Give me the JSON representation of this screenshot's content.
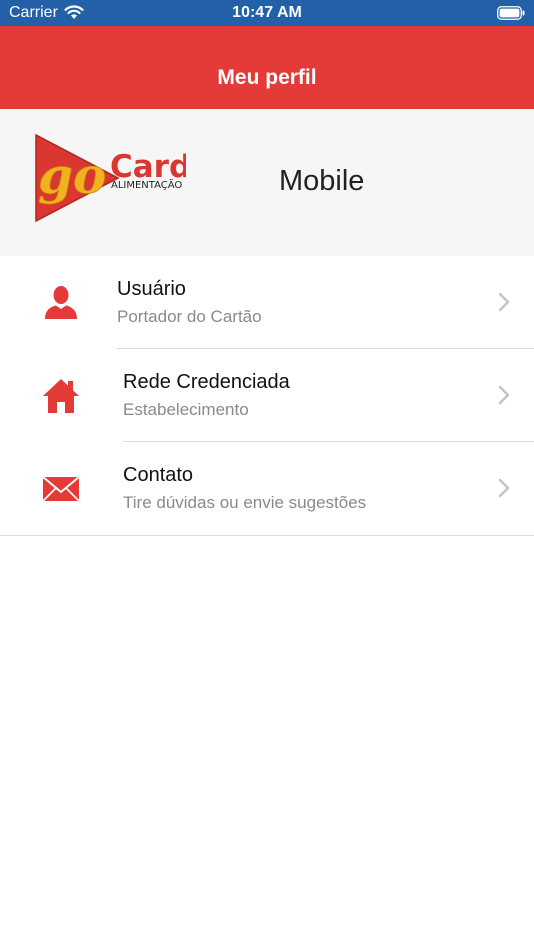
{
  "status": {
    "carrier": "Carrier",
    "time": "10:47 AM"
  },
  "navbar": {
    "title": "Meu perfil"
  },
  "header": {
    "logo": {
      "text_go": "go",
      "text_card": "Card",
      "text_sub": "ALIMENTAÇÃO"
    },
    "label": "Mobile"
  },
  "menu": {
    "items": [
      {
        "title": "Usuário",
        "subtitle": "Portador do Cartão",
        "icon": "user-icon"
      },
      {
        "title": "Rede Credenciada",
        "subtitle": "Estabelecimento",
        "icon": "home-icon"
      },
      {
        "title": "Contato",
        "subtitle": "Tire dúvidas ou envie sugestões",
        "icon": "mail-icon"
      }
    ]
  },
  "colors": {
    "status_bar": "#2360a8",
    "accent": "#e53b38",
    "header_bg": "#f6f6f6",
    "subtitle": "#8a8a8a"
  }
}
